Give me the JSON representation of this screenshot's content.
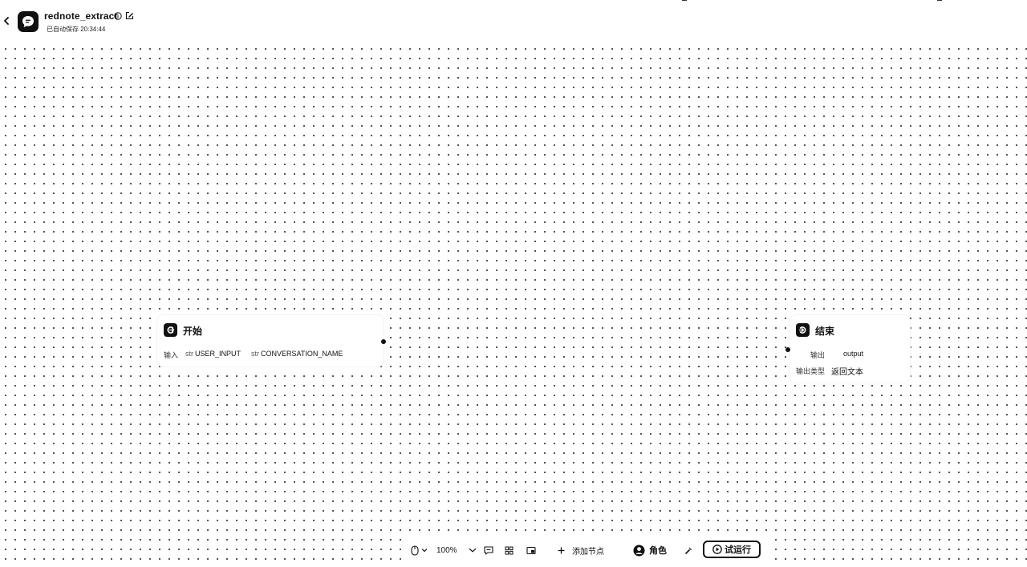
{
  "header": {
    "title": "rednote_extract",
    "save_status": "已自动保存 20:34:44"
  },
  "nodes": {
    "start": {
      "title": "开始",
      "input_label": "输入",
      "inputs": [
        {
          "type": "str",
          "name": "USER_INPUT"
        },
        {
          "type": "str",
          "name": "CONVERSATION_NAME"
        }
      ]
    },
    "end": {
      "title": "结束",
      "output_label": "输出",
      "output_value": "output",
      "output_type_label": "输出类型",
      "output_type_value": "返回文本"
    }
  },
  "toolbar": {
    "zoom": "100%",
    "add_node_label": "添加节点",
    "role_label": "角色",
    "run_label": "试运行"
  },
  "icons": {
    "back": "chevron-left-icon",
    "logo": "chat-bubble-icon",
    "info": "info-circle-icon",
    "edit": "edit-icon",
    "mouse": "mouse-icon",
    "comment": "comment-icon",
    "layout": "grid-layout-icon",
    "minimap": "minimap-icon",
    "add": "plus-icon",
    "role": "user-avatar-icon",
    "tool": "wrench-icon",
    "run": "play-icon"
  }
}
